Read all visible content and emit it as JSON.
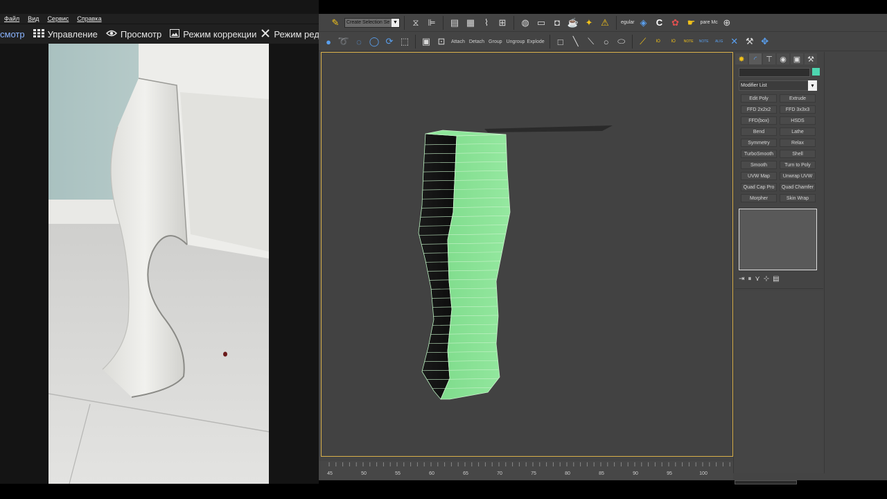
{
  "viewer": {
    "menu": [
      "Файл",
      "Вид",
      "Сервис",
      "Справка"
    ],
    "tabs": [
      {
        "label": "смотр",
        "icon": "",
        "active": true
      },
      {
        "label": "Управление",
        "icon": "grid-icon",
        "active": false
      },
      {
        "label": "Просмотр",
        "icon": "eye-icon",
        "active": false
      },
      {
        "label": "Режим коррекции",
        "icon": "image-icon",
        "active": false
      },
      {
        "label": "Режим редактора",
        "icon": "tools-icon",
        "active": false
      }
    ]
  },
  "max": {
    "toolbar1": {
      "selection_set": "Create Selection Se",
      "render_setup_label": "egular",
      "path_label": "pare Mc"
    },
    "toolbar2": {
      "text_buttons": [
        "Attach",
        "Detach",
        "Group",
        "Ungroup",
        "Explode"
      ],
      "snap_labels": [
        "IO",
        "IO",
        "NOTE",
        "NOTE",
        "ALIG",
        "ALIG"
      ]
    },
    "command_panel": {
      "tabs": [
        "create-icon",
        "modify-icon",
        "hierarchy-icon",
        "motion-icon",
        "display-icon",
        "utilities-icon"
      ],
      "object_color": "#4dd6b0",
      "modifier_list": "Modifier List",
      "modifier_buttons": [
        "Edit Poly",
        "Extrude",
        "FFD 2x2x2",
        "FFD 3x3x3",
        "FFD(box)",
        "HSDS",
        "Bend",
        "Lathe",
        "Symmetry",
        "Relax",
        "TurboSmooth",
        "Shell",
        "Smooth",
        "Turn to Poly",
        "UVW Map",
        "Unwrap UVW",
        "Quad Cap Pro",
        "Quad Chamfer",
        "Morpher",
        "Skin Wrap"
      ]
    },
    "timeline": {
      "ticks": [
        "45",
        "50",
        "55",
        "60",
        "65",
        "70",
        "75",
        "80",
        "85",
        "90",
        "95",
        "100"
      ]
    },
    "viewport": {
      "mesh_color": "#8ee69a",
      "wire_color": "#c9f3cb",
      "border_color": "#d9b04a"
    }
  }
}
